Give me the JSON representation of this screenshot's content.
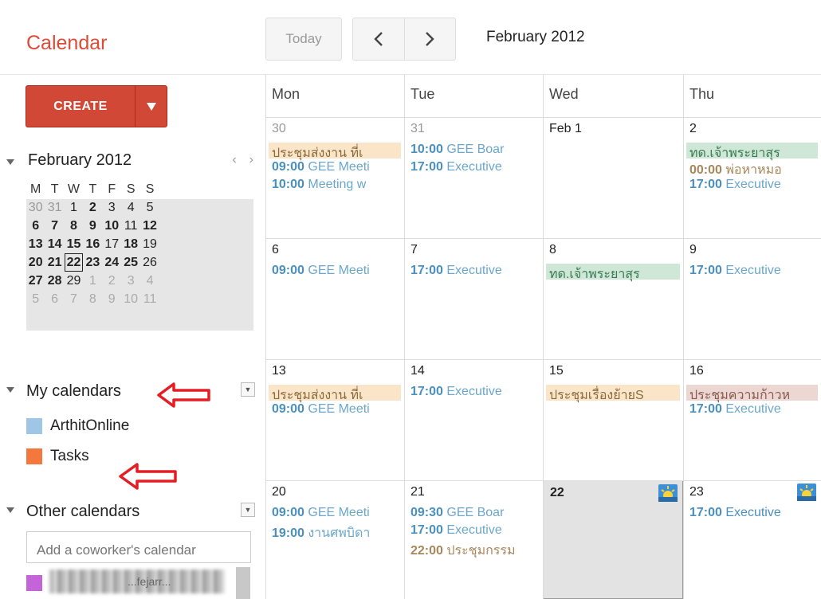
{
  "header": {
    "app_title": "Calendar",
    "today_label": "Today",
    "range_title": "February 2012"
  },
  "sidebar": {
    "create_label": "CREATE",
    "mini_calendar": {
      "title": "February 2012",
      "dow": [
        "M",
        "T",
        "W",
        "T",
        "F",
        "S",
        "S"
      ],
      "weeks": [
        [
          "30",
          "31",
          "1",
          "2",
          "3",
          "4",
          "5"
        ],
        [
          "6",
          "7",
          "8",
          "9",
          "10",
          "11",
          "12"
        ],
        [
          "13",
          "14",
          "15",
          "16",
          "17",
          "18",
          "19"
        ],
        [
          "20",
          "21",
          "22",
          "23",
          "24",
          "25",
          "26"
        ],
        [
          "27",
          "28",
          "29",
          "1",
          "2",
          "3",
          "4"
        ],
        [
          "5",
          "6",
          "7",
          "8",
          "9",
          "10",
          "11"
        ]
      ],
      "bold_days": [
        "2",
        "6",
        "7",
        "8",
        "9",
        "10",
        "12",
        "13",
        "14",
        "15",
        "16",
        "18",
        "20",
        "21",
        "22",
        "23",
        "24",
        "25",
        "27",
        "28"
      ],
      "today": "22"
    },
    "my_calendars": {
      "label": "My calendars",
      "items": [
        {
          "name": "ArthitOnline",
          "color": "#9fc6e7"
        },
        {
          "name": "Tasks",
          "color": "#f4783d"
        }
      ]
    },
    "other_calendars": {
      "label": "Other calendars",
      "add_placeholder": "Add a coworker's calendar",
      "items": [
        {
          "name": "...fejarr...",
          "color": "#c365d8"
        }
      ]
    }
  },
  "grid": {
    "days": [
      "Mon",
      "Tue",
      "Wed",
      "Thu"
    ],
    "weeks": [
      {
        "cells": [
          {
            "num": "30",
            "past": true,
            "events": [
              {
                "kind": "chip",
                "color": "peach",
                "text": "ประชุมส่งงาน ที่เ"
              },
              {
                "kind": "timed",
                "time": "09:00",
                "text": "GEE Meeti"
              },
              {
                "kind": "timed",
                "time": "10:00",
                "text": "Meeting w"
              }
            ]
          },
          {
            "num": "31",
            "past": true,
            "events": [
              {
                "kind": "timed",
                "time": "10:00",
                "text": "GEE Boar"
              },
              {
                "kind": "timed",
                "time": "17:00",
                "text": "Executive"
              }
            ]
          },
          {
            "num": "Feb 1",
            "events": []
          },
          {
            "num": "2",
            "events": [
              {
                "kind": "chip",
                "color": "green",
                "text": "ทด.เจ้าพระยาสุร"
              },
              {
                "kind": "timed-orange",
                "time": "00:00",
                "text": "พ่อหาหมอ"
              },
              {
                "kind": "timed",
                "time": "17:00",
                "text": "Executive"
              }
            ]
          }
        ]
      },
      {
        "cells": [
          {
            "num": "6",
            "events": [
              {
                "kind": "timed",
                "time": "09:00",
                "text": "GEE Meeti"
              }
            ]
          },
          {
            "num": "7",
            "events": [
              {
                "kind": "timed",
                "time": "17:00",
                "text": "Executive"
              }
            ]
          },
          {
            "num": "8",
            "events": [
              {
                "kind": "chip",
                "color": "green",
                "text": "ทด.เจ้าพระยาสุร"
              }
            ]
          },
          {
            "num": "9",
            "events": [
              {
                "kind": "timed",
                "time": "17:00",
                "text": "Executive"
              }
            ]
          }
        ]
      },
      {
        "cells": [
          {
            "num": "13",
            "events": [
              {
                "kind": "chip",
                "color": "peach",
                "text": "ประชุมส่งงาน ที่เ"
              },
              {
                "kind": "timed",
                "time": "09:00",
                "text": "GEE Meeti"
              }
            ]
          },
          {
            "num": "14",
            "events": [
              {
                "kind": "timed",
                "time": "17:00",
                "text": "Executive"
              }
            ]
          },
          {
            "num": "15",
            "events": [
              {
                "kind": "chip",
                "color": "peach",
                "text": "ประชุมเรื่องย้ายS"
              }
            ]
          },
          {
            "num": "16",
            "events": [
              {
                "kind": "chip",
                "color": "rose",
                "text": "ประชุมความก้าวห"
              },
              {
                "kind": "timed",
                "time": "17:00",
                "text": "Executive"
              }
            ]
          }
        ]
      },
      {
        "cells": [
          {
            "num": "20",
            "events": [
              {
                "kind": "timed",
                "time": "09:00",
                "text": "GEE Meeti"
              },
              {
                "kind": "timed",
                "time": "19:00",
                "text": "งานศพบิดา"
              }
            ]
          },
          {
            "num": "21",
            "events": [
              {
                "kind": "timed",
                "time": "09:30",
                "text": "GEE Boar"
              },
              {
                "kind": "timed",
                "time": "17:00",
                "text": "Executive"
              },
              {
                "kind": "timed-orange",
                "time": "22:00",
                "text": "ประชุมกรรม"
              }
            ]
          },
          {
            "num": "22",
            "bold": true,
            "selected": true,
            "icon": true,
            "events": []
          },
          {
            "num": "23",
            "icon": true,
            "events": [
              {
                "kind": "timed-dark",
                "time": "17:00",
                "text": "Executive"
              }
            ]
          }
        ]
      }
    ]
  }
}
